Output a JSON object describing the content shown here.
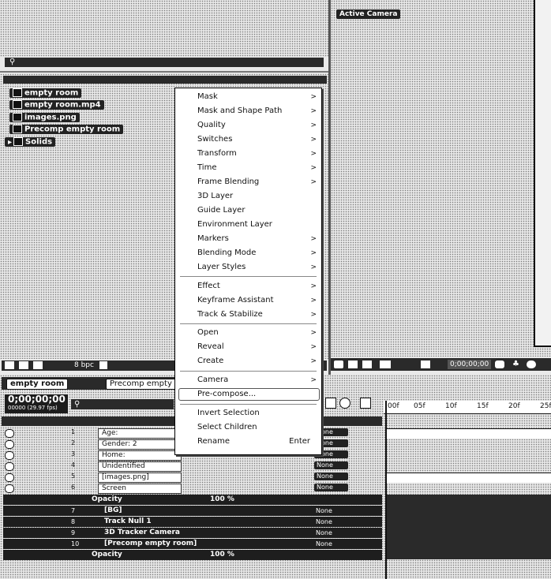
{
  "project": {
    "items": [
      {
        "label": "empty room",
        "icon": "composition-icon"
      },
      {
        "label": "empty room.mp4",
        "icon": "footage-icon"
      },
      {
        "label": "images.png",
        "icon": "image-icon"
      },
      {
        "label": "Precomp empty room",
        "icon": "composition-icon"
      },
      {
        "label": "Solids",
        "icon": "folder-icon"
      }
    ],
    "footer_bpc": "8 bpc"
  },
  "viewer": {
    "camera_label": "Active Camera",
    "timecode": "0;00;00;00"
  },
  "context_menu": {
    "items": [
      {
        "label": "Mask",
        "submenu": true
      },
      {
        "label": "Mask and Shape Path",
        "submenu": true
      },
      {
        "label": "Quality",
        "submenu": true
      },
      {
        "label": "Switches",
        "submenu": true
      },
      {
        "label": "Transform",
        "submenu": true
      },
      {
        "label": "Time",
        "submenu": true
      },
      {
        "label": "Frame Blending",
        "submenu": true
      },
      {
        "label": "3D Layer",
        "submenu": false
      },
      {
        "label": "Guide Layer",
        "submenu": false
      },
      {
        "label": "Environment Layer",
        "submenu": false
      },
      {
        "label": "Markers",
        "submenu": true
      },
      {
        "label": "Blending Mode",
        "submenu": true
      },
      {
        "label": "Layer Styles",
        "submenu": true
      },
      {
        "label": "Effect",
        "submenu": true
      },
      {
        "label": "Keyframe Assistant",
        "submenu": true
      },
      {
        "label": "Track & Stabilize",
        "submenu": true
      },
      {
        "label": "Open",
        "submenu": true
      },
      {
        "label": "Reveal",
        "submenu": true
      },
      {
        "label": "Create",
        "submenu": true
      },
      {
        "label": "Camera",
        "submenu": true
      },
      {
        "label": "Pre-compose...",
        "submenu": false,
        "highlighted": true
      },
      {
        "label": "Invert Selection",
        "submenu": false
      },
      {
        "label": "Select Children",
        "submenu": false
      },
      {
        "label": "Rename",
        "submenu": false,
        "shortcut": "Enter"
      }
    ]
  },
  "timeline": {
    "tabs": [
      "empty room",
      "Precomp empty"
    ],
    "timecode": "0;00;00;00",
    "frame_info": "00000 (29.97 fps)",
    "ruler": [
      ":00f",
      "05f",
      "10f",
      "15f",
      "20f",
      "25f"
    ],
    "layers": [
      {
        "num": "1",
        "name": "Age:",
        "mode": "None"
      },
      {
        "num": "2",
        "name": "Gender: 2",
        "mode": "None"
      },
      {
        "num": "3",
        "name": "Home:",
        "mode": "None"
      },
      {
        "num": "4",
        "name": "Unidentified",
        "mode": "None"
      },
      {
        "num": "5",
        "name": "[images.png]",
        "mode": "None"
      },
      {
        "num": "6",
        "name": "Screen",
        "mode": "None"
      }
    ],
    "opacity_rows": [
      {
        "label": "Opacity",
        "value": "100 %"
      },
      {
        "label": "Opacity",
        "value": "100 %"
      }
    ],
    "sel_layers": [
      {
        "num": "7",
        "name": "[BG]",
        "mode": "None"
      },
      {
        "num": "8",
        "name": "Track Null 1",
        "mode": "None"
      },
      {
        "num": "9",
        "name": "3D Tracker Camera",
        "mode": "None"
      },
      {
        "num": "10",
        "name": "[Precomp empty room]",
        "mode": "None"
      }
    ]
  }
}
